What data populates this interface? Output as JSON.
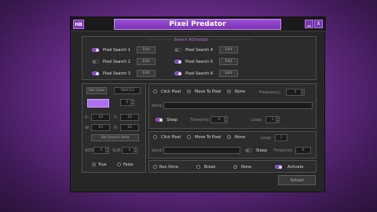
{
  "window": {
    "title": "Pixel Predator",
    "logo": "HB",
    "min_icon": "minimize-icon",
    "close_label": "X"
  },
  "search_activation": {
    "title": "Search Activation",
    "items": [
      {
        "label": "Pixel Search 1",
        "edit": "Edit",
        "on": true
      },
      {
        "label": "Pixel Search 2",
        "edit": "Edit",
        "on": false
      },
      {
        "label": "Pixel Search 3",
        "edit": "Edit",
        "on": true
      },
      {
        "label": "Pixel Search 4",
        "edit": "Edit",
        "on": false
      },
      {
        "label": "Pixel Search 5",
        "edit": "Edit",
        "on": true
      },
      {
        "label": "Pixel Search 6",
        "edit": "Edit",
        "on": true
      }
    ]
  },
  "left_panel": {
    "set_color": "Set Color",
    "color_hex": "7B4CA3",
    "color_value": "#b06ef0",
    "shade_label": "0",
    "x_label": "X:",
    "x_value": "10",
    "y_label": "Y:",
    "y_value": "10",
    "w_label": "W:",
    "w_value": "10",
    "h_label": "H:",
    "h_value": "10",
    "set_search_area": "Set Search Area",
    "add_label": "ADD:",
    "add_value": "0",
    "sub_label": "SUB:",
    "sub_value": "0",
    "true_label": "True",
    "false_label": "False"
  },
  "action1": {
    "click_pixel": "Click Pixel",
    "move_to_pixel": "Move To Pixel",
    "none": "None",
    "frequency_label": "Frequency:",
    "frequency_value": "1",
    "send_label": "Send:",
    "send_value": "",
    "sleep_label": "Sleep",
    "time_label": "Time(ms):",
    "time_value": "0",
    "loop_label": "Loop:",
    "loop_value": "1"
  },
  "action2": {
    "click_pixel": "Click Pixel",
    "move_to_pixel": "Move To Pixel",
    "none": "None",
    "loop_label": "Loop:",
    "loop_value": "1",
    "send_label": "Send:",
    "send_value": "",
    "sleep_label": "Sleep",
    "time_label": "Time(ms):",
    "time_value": "0"
  },
  "bottom": {
    "run_once": "Run Once",
    "break": "Break",
    "none": "None",
    "activate": "Activate",
    "reload": "Reload"
  },
  "colors": {
    "accent": "#8a3fc8",
    "bg": "#262626"
  }
}
